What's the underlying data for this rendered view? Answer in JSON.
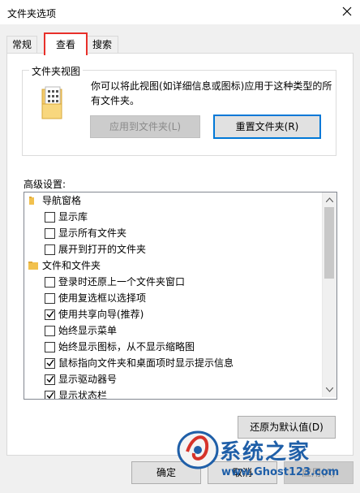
{
  "window": {
    "title": "文件夹选项"
  },
  "tabs": [
    {
      "label": "常规",
      "active": false
    },
    {
      "label": "查看",
      "active": true
    },
    {
      "label": "搜索",
      "active": false
    }
  ],
  "folder_view": {
    "group_title": "文件夹视图",
    "description": "你可以将此视图(如详细信息或图标)应用于这种类型的所有文件夹。",
    "apply_button": "应用到文件夹(L)",
    "reset_button": "重置文件夹(R)"
  },
  "advanced": {
    "label": "高级设置:",
    "items": [
      {
        "type": "group",
        "label": "导航窗格"
      },
      {
        "type": "checkbox",
        "label": "显示库",
        "checked": false
      },
      {
        "type": "checkbox",
        "label": "显示所有文件夹",
        "checked": false
      },
      {
        "type": "checkbox",
        "label": "展开到打开的文件夹",
        "checked": false
      },
      {
        "type": "group",
        "label": "文件和文件夹"
      },
      {
        "type": "checkbox",
        "label": "登录时还原上一个文件夹窗口",
        "checked": false
      },
      {
        "type": "checkbox",
        "label": "使用复选框以选择项",
        "checked": false
      },
      {
        "type": "checkbox",
        "label": "使用共享向导(推荐)",
        "checked": true
      },
      {
        "type": "checkbox",
        "label": "始终显示菜单",
        "checked": false
      },
      {
        "type": "checkbox",
        "label": "始终显示图标，从不显示缩略图",
        "checked": false
      },
      {
        "type": "checkbox",
        "label": "鼠标指向文件夹和桌面项时显示提示信息",
        "checked": true
      },
      {
        "type": "checkbox",
        "label": "显示驱动器号",
        "checked": true
      },
      {
        "type": "checkbox",
        "label": "显示状态栏",
        "checked": true
      }
    ]
  },
  "restore_defaults_button": "还原为默认值(D)",
  "footer": {
    "ok": "确定",
    "cancel": "取消",
    "apply": "应用(A)"
  },
  "watermark": {
    "brand": "系统之家",
    "url": "www.Ghost123.com"
  },
  "colors": {
    "highlight_tab_border": "#e8302a",
    "focus_border": "#0078d7"
  }
}
